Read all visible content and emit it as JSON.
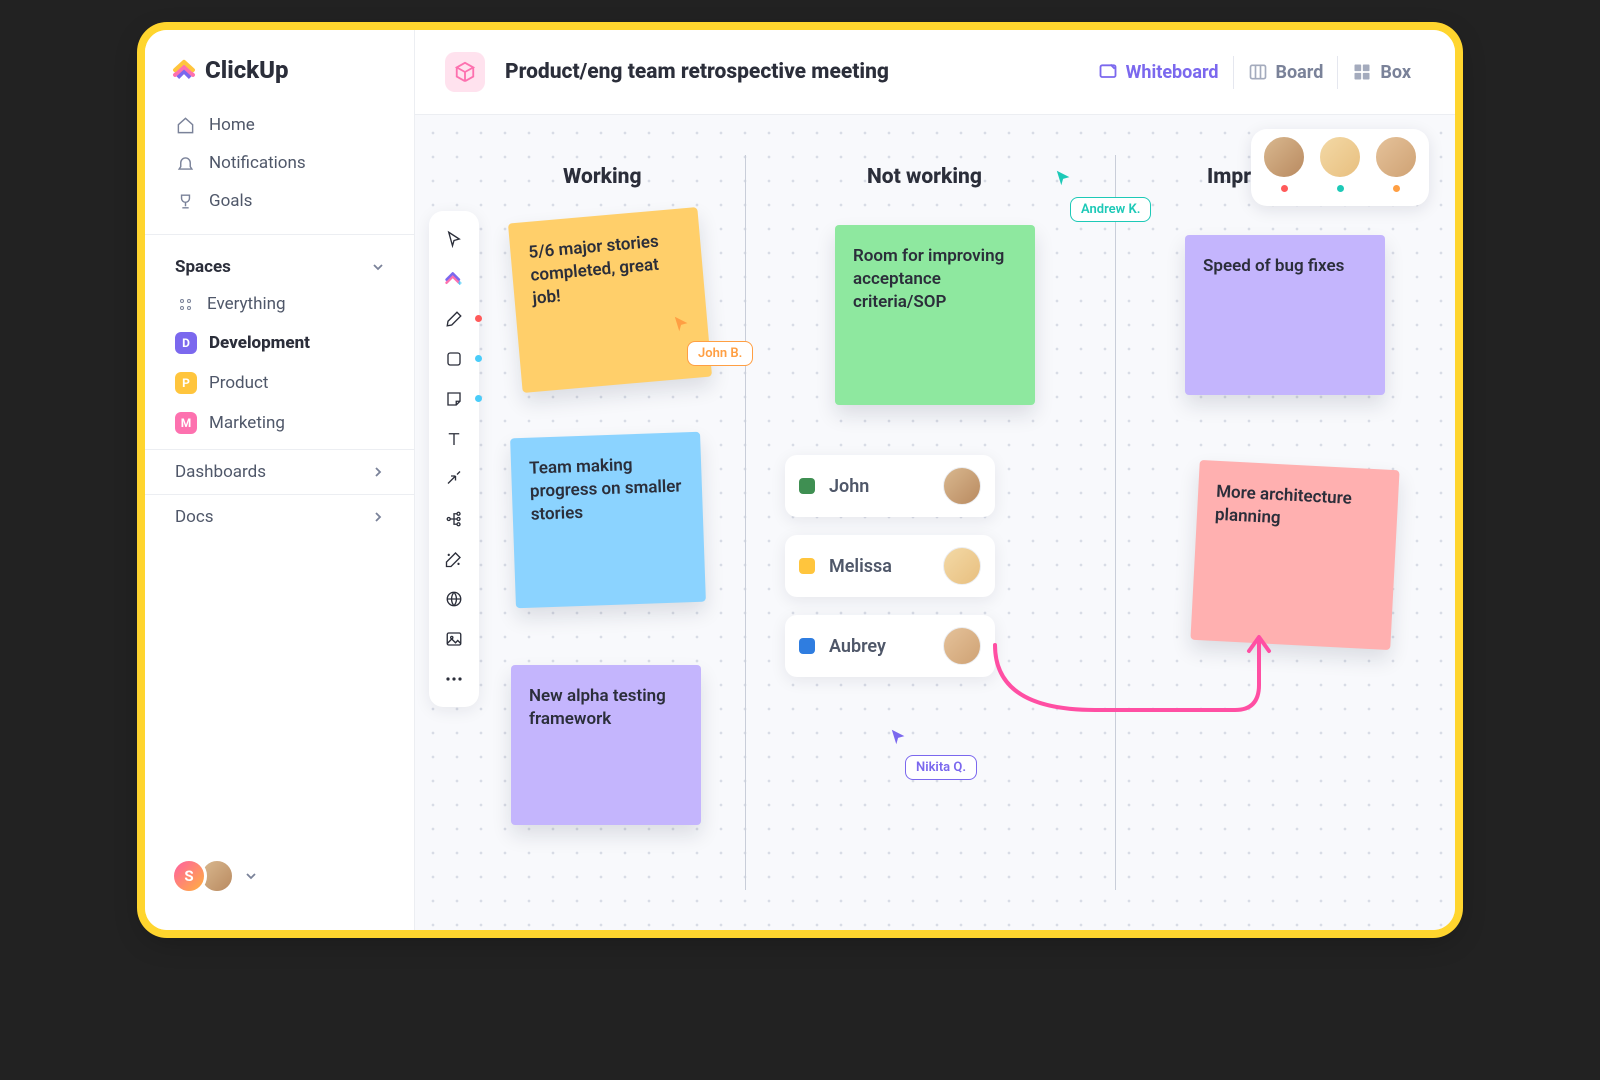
{
  "app": {
    "name": "ClickUp"
  },
  "nav": {
    "home": "Home",
    "notifications": "Notifications",
    "goals": "Goals"
  },
  "spaces": {
    "heading": "Spaces",
    "everything": "Everything",
    "items": [
      {
        "letter": "D",
        "label": "Development",
        "color": "#7b68ee",
        "active": true
      },
      {
        "letter": "P",
        "label": "Product",
        "color": "#ffc53d",
        "active": false
      },
      {
        "letter": "M",
        "label": "Marketing",
        "color": "#fd71af",
        "active": false
      }
    ]
  },
  "bottom": {
    "dashboards": "Dashboards",
    "docs": "Docs"
  },
  "user": {
    "initial": "S"
  },
  "header": {
    "title": "Product/eng team retrospective meeting",
    "tabs": {
      "whiteboard": "Whiteboard",
      "board": "Board",
      "box": "Box"
    }
  },
  "columns": {
    "working": "Working",
    "notworking": "Not working",
    "improve": "Improve"
  },
  "stickies": {
    "s1": "5/6 major stories completed, great job!",
    "s2": "Team making progress on smaller stories",
    "s3": "New alpha testing framework",
    "s4": "Room for improving acceptance criteria/SOP",
    "s5": "Speed of bug fixes",
    "s6": "More architecture planning"
  },
  "people": {
    "john": "John",
    "melissa": "Melissa",
    "aubrey": "Aubrey"
  },
  "cursors": {
    "john_b": "John B.",
    "andrew_k": "Andrew K.",
    "nikita_q": "Nikita Q."
  },
  "presence_colors": [
    "#ff5a5a",
    "#1dc9b7",
    "#ff9f43"
  ]
}
